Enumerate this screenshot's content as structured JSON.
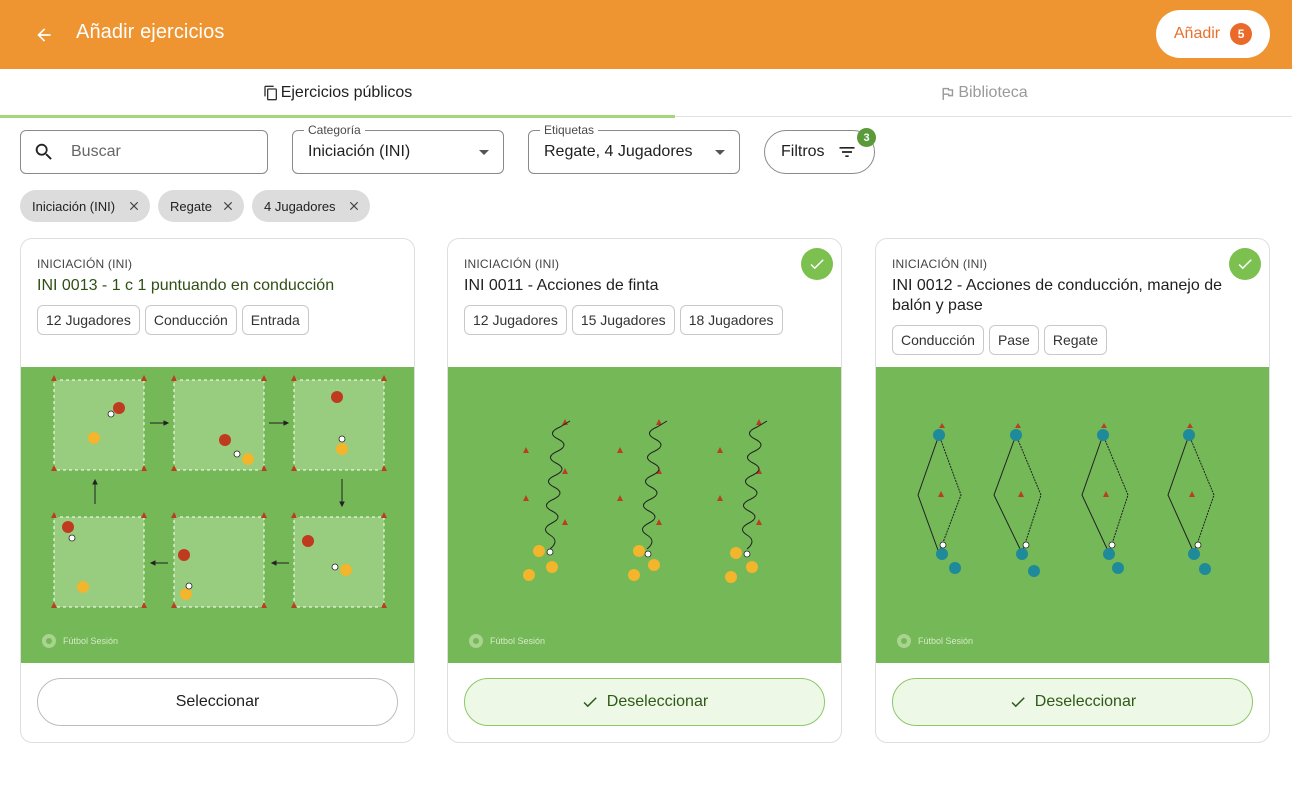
{
  "header": {
    "title": "Añadir ejercicios",
    "add_label": "Añadir",
    "add_count": "5",
    "back_icon": "arrow-left-icon"
  },
  "tabs": [
    {
      "label": "Ejercicios públicos",
      "icon": "copy-icon",
      "active": true
    },
    {
      "label": "Biblioteca",
      "icon": "flag-icon",
      "active": false
    }
  ],
  "filters": {
    "search_placeholder": "Buscar",
    "category": {
      "label": "Categoría",
      "value": "Iniciación (INI)"
    },
    "labels": {
      "label": "Etiquetas",
      "value": "Regate, 4 Jugadores"
    },
    "filters_label": "Filtros",
    "filters_count": "3"
  },
  "chips": [
    "Iniciación (INI)",
    "Regate",
    "4 Jugadores"
  ],
  "cards": [
    {
      "category": "INICIACIÓN (INI)",
      "title": "INI 0013 - 1 c 1 puntuando en conducción",
      "tags": [
        "12 Jugadores",
        "Conducción",
        "Entrada"
      ],
      "selected": false,
      "button": "Seleccionar",
      "watermark": "Fútbol Sesión"
    },
    {
      "category": "INICIACIÓN (INI)",
      "title": "INI 0011 - Acciones de finta",
      "tags": [
        "12 Jugadores",
        "15 Jugadores",
        "18 Jugadores"
      ],
      "selected": true,
      "button": "Deseleccionar",
      "watermark": "Fútbol Sesión"
    },
    {
      "category": "INICIACIÓN (INI)",
      "title": "INI 0012 - Acciones de conducción, manejo de balón y pase",
      "tags": [
        "Conducción",
        "Pase",
        "Regate"
      ],
      "selected": true,
      "button": "Deseleccionar",
      "watermark": "Fútbol Sesión"
    }
  ],
  "colors": {
    "appbar": "#ee9532",
    "accent_green": "#7cc050",
    "pitch": "#74b857",
    "badge_orange": "#ea6a2a"
  }
}
